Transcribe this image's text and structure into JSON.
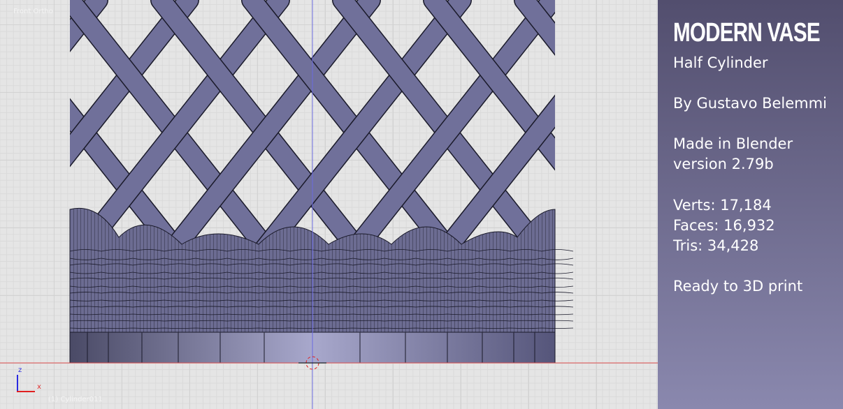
{
  "viewport": {
    "view_label": "Front Ortho",
    "object_label": "(1) Cylinder011",
    "axis_z": "z",
    "axis_x": "x"
  },
  "panel": {
    "title": "MODERN VASE",
    "subtitle": "Half Cylinder",
    "author": "By Gustavo Belemmi",
    "made_in": "Made in Blender",
    "version": "version 2.79b",
    "verts": "Verts: 17,184",
    "faces": "Faces: 16,932",
    "tris": "Tris: 34,428",
    "status": "Ready to 3D print"
  },
  "colors": {
    "mesh": "#6a6a90",
    "panel_top": "#524e6e",
    "panel_bottom": "#8a88ae",
    "x_axis": "#e03030",
    "z_axis": "#3030e0"
  }
}
